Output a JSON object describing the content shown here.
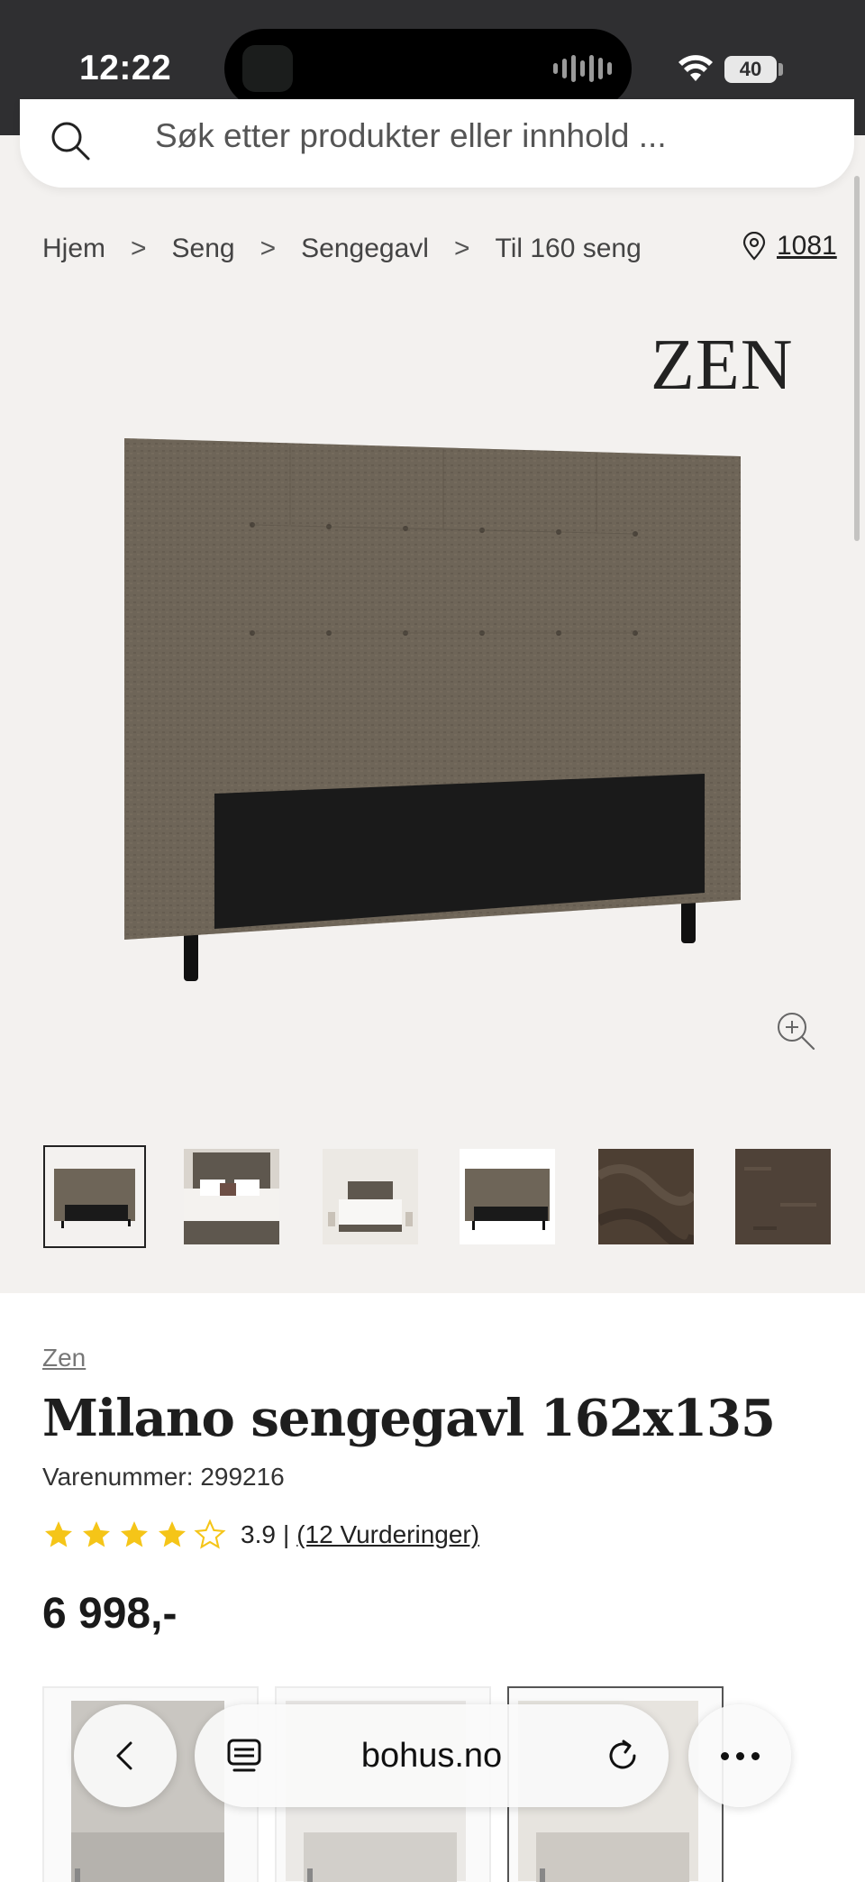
{
  "status_bar": {
    "time": "12:22",
    "battery": "40"
  },
  "search": {
    "placeholder": "Søk etter produkter eller innhold ..."
  },
  "breadcrumb": {
    "items": [
      "Hjem",
      "Seng",
      "Sengegavl",
      "Til 160 seng"
    ],
    "separator": ">"
  },
  "store": {
    "label": "1081"
  },
  "product": {
    "brand_logo": "ZEN",
    "brand": "Zen",
    "title": "Milano sengegavl 162x135",
    "sku": "Varenummer: 299216",
    "rating": {
      "value": "3.9",
      "separator": "|",
      "reviews": "(12 Vurderinger)",
      "stars_filled": 3.9,
      "stars_total": 5
    },
    "price": "6 998,-"
  },
  "thumbnails": [
    "headboard-front",
    "bedroom-1",
    "bedroom-2",
    "headboard-white",
    "fabric-1",
    "fabric-2"
  ],
  "browser": {
    "url": "bohus.no"
  },
  "colors": {
    "star": "#f5c518",
    "fabric": "#6e6558",
    "panel": "#1a1a1a",
    "status_bg": "#2f2f31"
  }
}
